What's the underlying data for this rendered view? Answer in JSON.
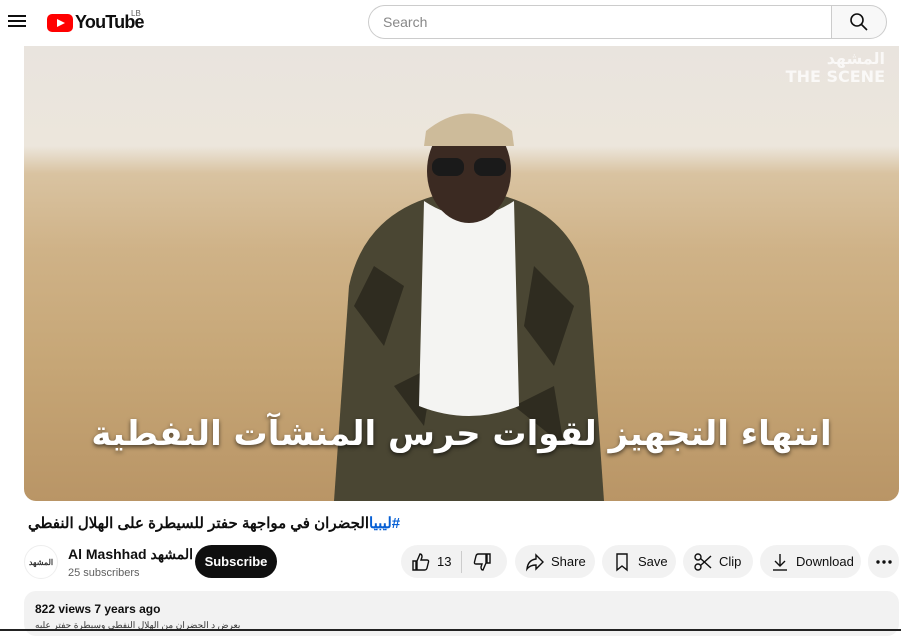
{
  "header": {
    "logo_text": "YouTube",
    "country_code": "LB",
    "search_placeholder": "Search"
  },
  "video": {
    "watermark_arabic": "المشهد",
    "watermark_latin": "THE SCENE",
    "caption": "انتهاء التجهيز لقوات حرس المنشآت النفطية"
  },
  "title": {
    "hashtag": "#ليبيا",
    "text": "الجضران في مواجهة حفتر للسيطرة على الهلال النفطي"
  },
  "channel": {
    "avatar_text": "المشهد",
    "name": "Al Mashhad المشهد",
    "subscribers": "25 subscribers",
    "subscribe_label": "Subscribe"
  },
  "actions": {
    "likes": "13",
    "share_label": "Share",
    "save_label": "Save",
    "clip_label": "Clip",
    "download_label": "Download"
  },
  "description": {
    "meta": "822 views  7 years ago",
    "text": "يعرض د الجضران من الهلال النفطي وسيطرة حفتر عليه"
  },
  "colors": {
    "brand": "#ff0000",
    "link": "#065fd4"
  }
}
